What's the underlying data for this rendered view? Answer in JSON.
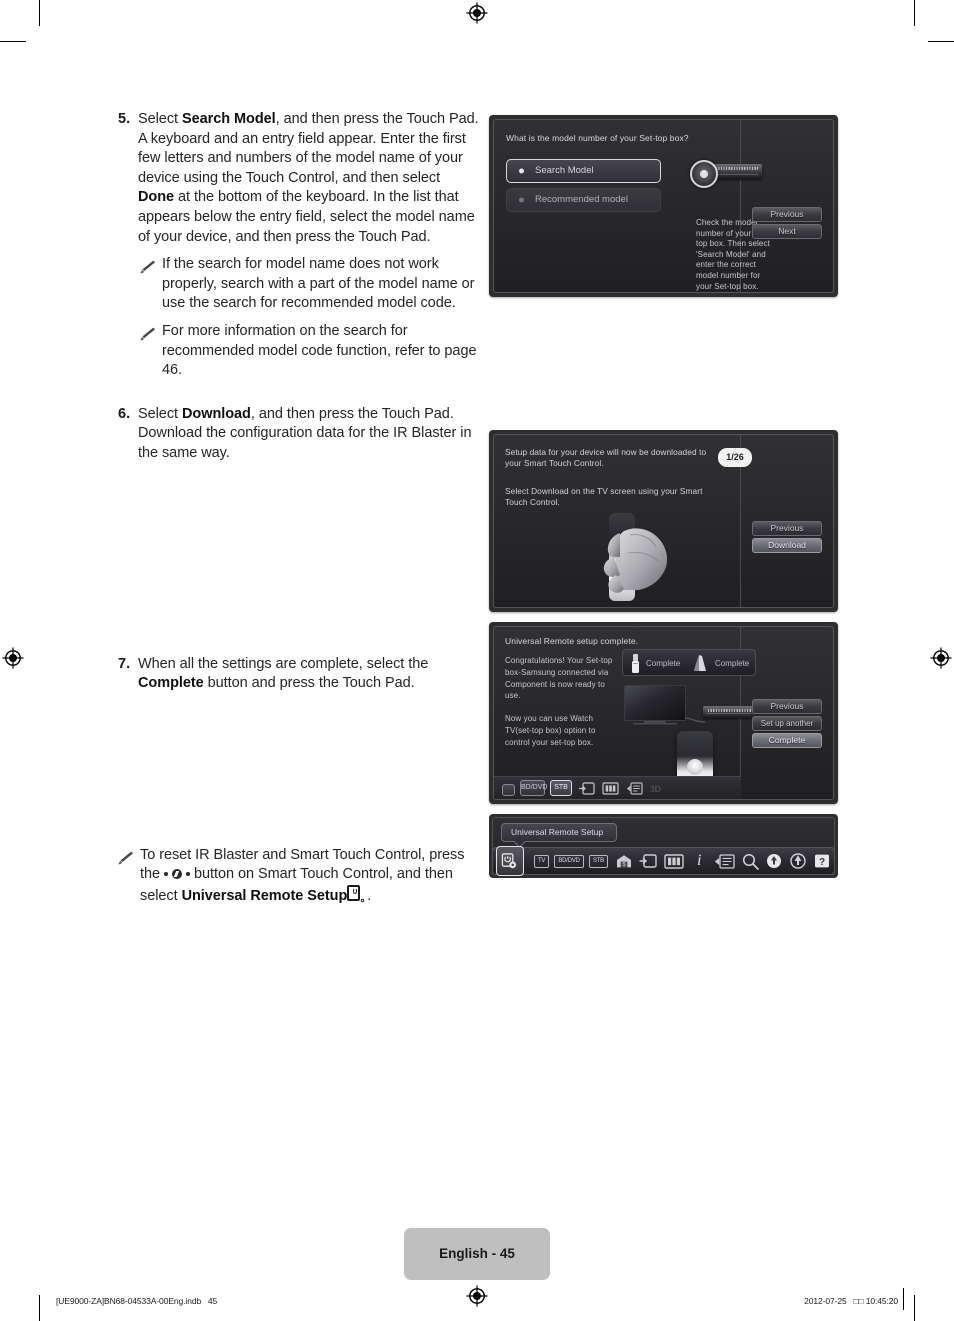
{
  "document": {
    "page_label": "English - 45",
    "footer_left": "[UE9000-ZA]BN68-04533A-00Eng.indb   45",
    "footer_right": "2012-07-25   □□ 10:45:20"
  },
  "instructions": [
    {
      "number": "5.",
      "text_parts": [
        {
          "t": "Select ",
          "b": false
        },
        {
          "t": "Search Model",
          "b": true
        },
        {
          "t": ", and then press the Touch Pad. A keyboard and an entry field appear. Enter the first few letters and numbers of the model name of your device using the Touch Control, and then select ",
          "b": false
        },
        {
          "t": "Done",
          "b": true
        },
        {
          "t": " at the bottom of the keyboard. In the list that appears below the entry field, select the model name of your device, and then press the Touch Pad.",
          "b": false
        }
      ]
    },
    {
      "number": "6.",
      "text_parts": [
        {
          "t": "Select ",
          "b": false
        },
        {
          "t": "Download",
          "b": true
        },
        {
          "t": ", and then press the Touch Pad. Download the configuration data for the IR Blaster in the same way.",
          "b": false
        }
      ]
    },
    {
      "number": "7.",
      "text_parts": [
        {
          "t": "When all the settings are complete, select the ",
          "b": false
        },
        {
          "t": "Complete",
          "b": true
        },
        {
          "t": " button and press the Touch Pad.",
          "b": false
        }
      ]
    }
  ],
  "notes": [
    {
      "id": "note-search-fail",
      "text_parts": [
        {
          "t": "If the search for model name does not work properly, search with a part of the model name or use the search for recommended model code.",
          "b": false
        }
      ]
    },
    {
      "id": "note-refer-page",
      "text_parts": [
        {
          "t": "For more information on the search for recommended model code function, refer to page 46.",
          "b": false
        }
      ]
    },
    {
      "id": "note-reset-ir-blaster",
      "text_parts": [
        {
          "t": "To reset IR Blaster and Smart Touch Control, press the ",
          "b": false
        },
        {
          "t": "●●●",
          "b": false,
          "glyph": "more-button-icon"
        },
        {
          "t": " button on Smart Touch Control, and then select ",
          "b": false
        },
        {
          "t": "Universal Remote Setup",
          "b": true
        },
        {
          "t": " ⌘.",
          "b": false,
          "glyph": "universal-remote-setup-icon"
        }
      ]
    }
  ],
  "screens": [
    {
      "id": "screen-search-model",
      "title": "What is the model number of your Set-top box?",
      "options": [
        {
          "label": "Search Model",
          "selected": true
        },
        {
          "label": "Recommended model",
          "selected": false
        }
      ],
      "help_text": "Check the model number of your Set-top box. Then select 'Search Model' and enter the correct model number for your Set-top box.",
      "buttons": [
        {
          "label": "Previous",
          "highlighted": false
        },
        {
          "label": "Next",
          "highlighted": false
        }
      ]
    },
    {
      "id": "screen-download",
      "line1": "Setup data for your device will now be downloaded to your Smart Touch Control.",
      "line2": "Select Download on the TV screen using your Smart Touch Control.",
      "counter": "1/26",
      "buttons": [
        {
          "label": "Previous",
          "highlighted": false
        },
        {
          "label": "Download",
          "highlighted": true
        }
      ]
    },
    {
      "id": "screen-complete",
      "title": "Universal Remote setup complete.",
      "para1": "Congratulations! Your Set-top box-Samsung connected via Component is now ready to use.",
      "para2": "Now you can use Watch TV(set-top box) option to control your set-top box.",
      "status_chips": [
        {
          "label": "Complete",
          "icon": "ir-blaster-icon"
        },
        {
          "label": "Complete",
          "icon": "smart-touch-control-icon"
        }
      ],
      "source_chips": [
        {
          "label": "",
          "icon": "tv-icon",
          "active": false
        },
        {
          "label": "BD/DVD",
          "icon": "bd-dvd-icon",
          "active": false
        },
        {
          "label": "STB",
          "icon": "stb-icon",
          "active": true
        },
        {
          "label": "",
          "icon": "source-icon",
          "active": false
        },
        {
          "label": "",
          "icon": "channel-list-icon",
          "active": false
        },
        {
          "label": "",
          "icon": "guide-icon",
          "active": false
        },
        {
          "label": "3D",
          "icon": "3d-icon",
          "active": false
        }
      ],
      "buttons": [
        {
          "label": "Previous",
          "highlighted": false
        },
        {
          "label": "Set up another",
          "highlighted": false
        },
        {
          "label": "Complete",
          "highlighted": true
        }
      ]
    },
    {
      "id": "screen-toolbar",
      "tooltip": "Universal Remote Setup",
      "icons": [
        {
          "name": "universal-remote-setup-icon",
          "label": "",
          "selected": true
        },
        {
          "name": "tv-icon",
          "label": "TV",
          "selected": false
        },
        {
          "name": "bd-dvd-icon",
          "label": "BD/DVD",
          "selected": false
        },
        {
          "name": "stb-icon",
          "label": "STB",
          "selected": false
        },
        {
          "name": "smart-hub-icon",
          "label": "",
          "selected": false
        },
        {
          "name": "source-icon",
          "label": "",
          "selected": false
        },
        {
          "name": "channel-list-icon",
          "label": "",
          "selected": false
        },
        {
          "name": "info-icon",
          "label": "i",
          "selected": false
        },
        {
          "name": "guide-icon",
          "label": "",
          "selected": false
        },
        {
          "name": "search-icon",
          "label": "",
          "selected": false
        },
        {
          "name": "apps-icon",
          "label": "",
          "selected": false
        },
        {
          "name": "web-browser-icon",
          "label": "",
          "selected": false
        },
        {
          "name": "help-icon",
          "label": "?",
          "selected": false
        }
      ]
    }
  ]
}
